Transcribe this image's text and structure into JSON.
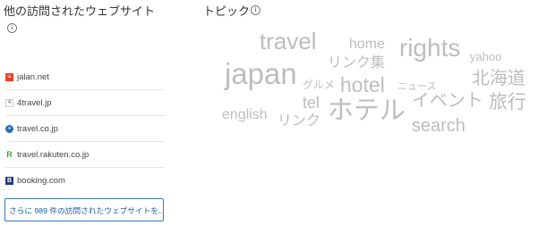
{
  "visited_sites": {
    "title": "他の訪問されたウェブサイト",
    "sites": [
      {
        "name": "jalan.net",
        "icon": "jalan-favicon",
        "color": "#e8412c"
      },
      {
        "name": "4travel.jp",
        "icon": "4travel-favicon",
        "color": "#8a8a8a"
      },
      {
        "name": "travel.co.jp",
        "icon": "travelcojp-favicon",
        "color": "#2a6fb4"
      },
      {
        "name": "travel.rakuten.co.jp",
        "icon": "rakuten-favicon",
        "color": "#3aa63a"
      },
      {
        "name": "booking.com",
        "icon": "booking-favicon",
        "color": "#243b7a"
      }
    ],
    "more_button": "さらに 989 件の訪問されたウェブサイトを..."
  },
  "topics": {
    "title": "トピック",
    "words": [
      "travel",
      "home",
      "rights",
      "yahoo",
      "japan",
      "リンク集",
      "北海道",
      "グルメ",
      "hotel",
      "ニュース",
      "イベント",
      "旅行",
      "tel",
      "english",
      "ホテル",
      "リンク",
      "search"
    ]
  },
  "colors": {
    "accent": "#1f5fa8",
    "word": "#bdbdbd"
  }
}
